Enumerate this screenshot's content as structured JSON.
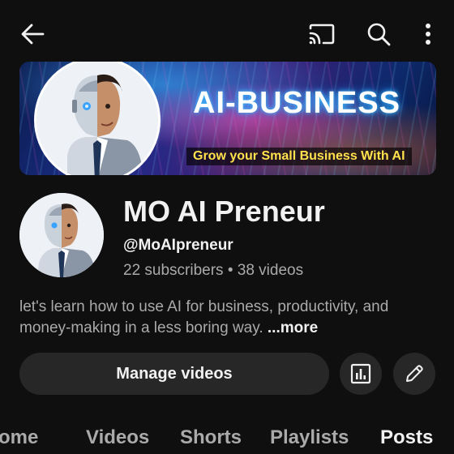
{
  "topbar": {
    "icons": [
      "back-arrow-icon",
      "cast-icon",
      "search-icon",
      "more-vertical-icon"
    ]
  },
  "banner": {
    "title": "AI-BUSINESS",
    "tagline": "Grow your Small Business With AI"
  },
  "channel": {
    "name": "MO AI Preneur",
    "handle": "@MoAIpreneur",
    "meta": "22 subscribers • 38 videos"
  },
  "description": {
    "text": "let's learn how to use AI for business, productivity, and money-making in a less boring way. ",
    "more_label": "...more"
  },
  "actions": {
    "manage_videos_label": "Manage videos",
    "analytics_icon": "analytics-icon",
    "edit_icon": "pencil-icon"
  },
  "tabs": [
    {
      "label": "ome",
      "active": false
    },
    {
      "label": "Videos",
      "active": false
    },
    {
      "label": "Shorts",
      "active": false
    },
    {
      "label": "Playlists",
      "active": false
    },
    {
      "label": "Posts",
      "active": true
    }
  ],
  "colors": {
    "background": "#0f0f0f",
    "surface": "#272727",
    "text_primary": "#f1f1f1",
    "text_secondary": "#aaaaaa",
    "banner_tagline": "#ffe14d"
  }
}
